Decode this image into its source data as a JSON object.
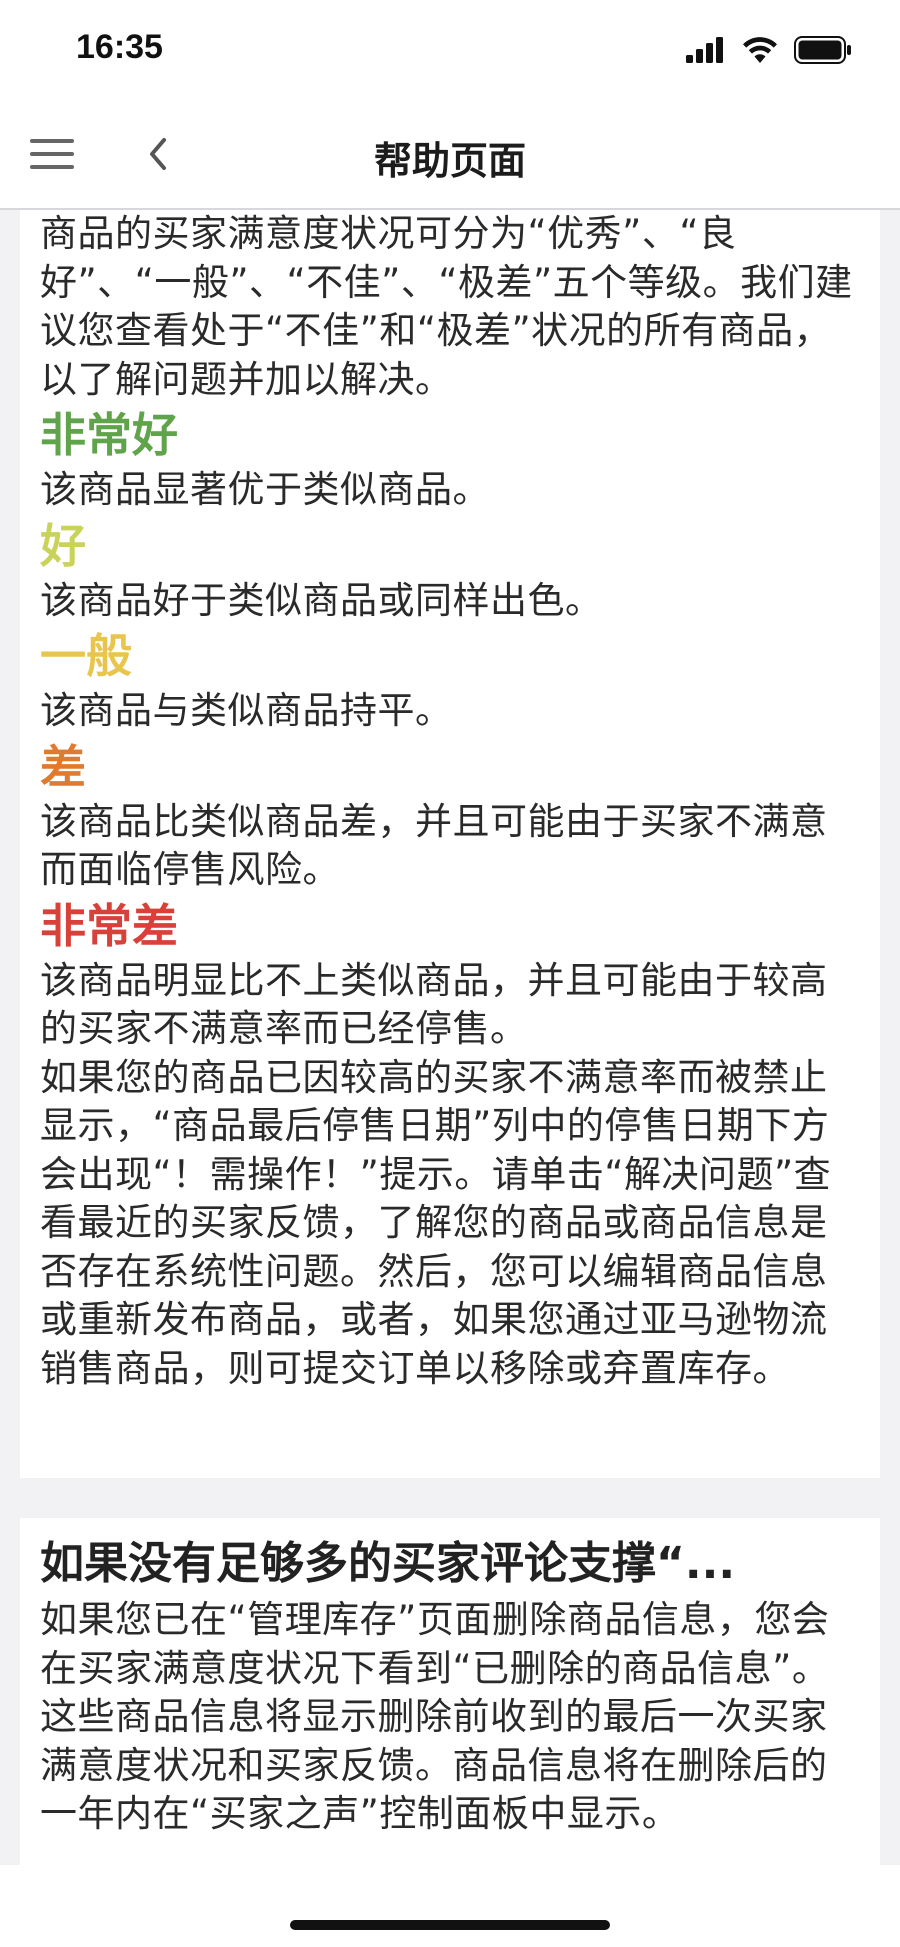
{
  "status_bar": {
    "time": "16:35"
  },
  "nav": {
    "title": "帮助页面"
  },
  "colors": {
    "very_good": "#5fa34a",
    "good": "#c9d35a",
    "average": "#e8c64d",
    "poor": "#e07a2e",
    "very_poor": "#d8413a"
  },
  "content": {
    "intro": "商品的买家满意度状况可分为“优秀”、“良好”、“一般”、“不佳”、“极差”五个等级。我们建议您查看处于“不佳”和“极差”状况的所有商品，以了解问题并加以解决。",
    "levels": [
      {
        "title": "非常好",
        "desc": "该商品显著优于类似商品。"
      },
      {
        "title": "好",
        "desc": "该商品好于类似商品或同样出色。"
      },
      {
        "title": "一般",
        "desc": "该商品与类似商品持平。"
      },
      {
        "title": "差",
        "desc": "该商品比类似商品差，并且可能由于买家不满意而面临停售风险。"
      },
      {
        "title": "非常差",
        "desc": "该商品明显比不上类似商品，并且可能由于较高的买家不满意率而已经停售。"
      }
    ],
    "closing": "如果您的商品已因较高的买家不满意率而被禁止显示，“商品最后停售日期”列中的停售日期下方会出现“！需操作！”提示。请单击“解决问题”查看最近的买家反馈，了解您的商品或商品信息是否存在系统性问题。然后，您可以编辑商品信息或重新发布商品，或者，如果您通过亚马逊物流销售商品，则可提交订单以移除或弃置库存。",
    "section2": {
      "heading": "如果没有足够多的买家评论支撑“...",
      "body": "如果您已在“管理库存”页面删除商品信息，您会在买家满意度状况下看到“已删除的商品信息”。这些商品信息将显示删除前收到的最后一次买家满意度状况和买家反馈。商品信息将在删除后的一年内在“买家之声”控制面板中显示。"
    }
  }
}
